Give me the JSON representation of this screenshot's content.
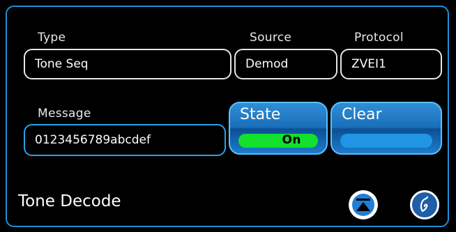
{
  "labels": {
    "type": "Type",
    "source": "Source",
    "protocol": "Protocol",
    "message": "Message"
  },
  "fields": {
    "type_value": "Tone Seq",
    "source_value": "Demod",
    "protocol_value": "ZVEI1",
    "message_value": "0123456789abcdef"
  },
  "buttons": {
    "state_label": "State",
    "state_value": "On",
    "clear_label": "Clear"
  },
  "footer": {
    "title": "Tone Decode",
    "icon_left": "scroll-to-top-icon",
    "icon_right": "dial-knob-icon"
  },
  "colors": {
    "accent_blue": "#1e8fd8",
    "on_green": "#14e02e",
    "background": "#000000"
  }
}
